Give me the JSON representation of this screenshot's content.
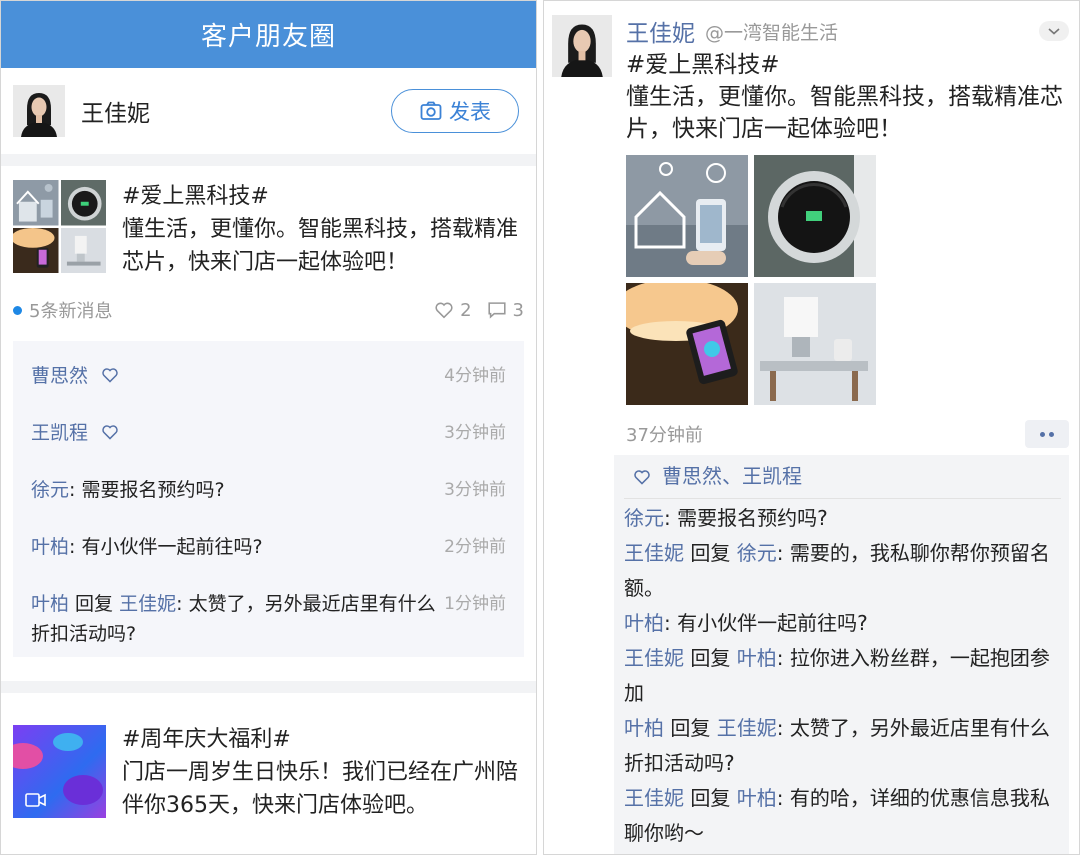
{
  "left": {
    "nav_title": "客户朋友圈",
    "me": {
      "name": "王佳妮",
      "post_button": "发表"
    },
    "post1": {
      "hashtag": "#爱上黑科技#",
      "text": "懂生活，更懂你。智能黑科技，搭载精准芯片，快来门店一起体验吧！",
      "new_messages": "5条新消息",
      "likes": "2",
      "comments": "3",
      "comment_list": [
        {
          "name": "曹思然",
          "text": "",
          "liked": true,
          "time": "4分钟前"
        },
        {
          "name": "王凯程",
          "text": "",
          "liked": true,
          "time": "3分钟前"
        },
        {
          "name": "徐元",
          "text": ": 需要报名预约吗?",
          "liked": false,
          "time": "3分钟前"
        },
        {
          "name": "叶柏",
          "text": ": 有小伙伴一起前往吗?",
          "liked": false,
          "time": "2分钟前"
        },
        {
          "name": "叶柏",
          "reply_word": " 回复 ",
          "reply_to": "王佳妮",
          "text": ": 太赞了，另外最近店里有什么折扣活动吗?",
          "liked": false,
          "time": "1分钟前"
        }
      ]
    },
    "post2": {
      "hashtag": "#周年庆大福利#",
      "text": "门店一周岁生日快乐！我们已经在广州陪伴你365天，快来门店体验吧。"
    }
  },
  "right": {
    "name": "王佳妮",
    "handle": "@一湾智能生活",
    "hashtag": "#爱上黑科技#",
    "text": "懂生活，更懂你。智能黑科技，搭载精准芯片，快来门店一起体验吧！",
    "time": "37分钟前",
    "likes_line": "曹思然、王凯程",
    "comments": [
      {
        "name": "徐元",
        "reply_word": "",
        "reply_to": "",
        "text": ": 需要报名预约吗?"
      },
      {
        "name": "王佳妮",
        "reply_word": " 回复 ",
        "reply_to": "徐元",
        "text": ": 需要的，我私聊你帮你预留名额。"
      },
      {
        "name": "叶柏",
        "reply_word": "",
        "reply_to": "",
        "text": ": 有小伙伴一起前往吗?"
      },
      {
        "name": "王佳妮",
        "reply_word": " 回复 ",
        "reply_to": "叶柏",
        "text": ": 拉你进入粉丝群，一起抱团参加"
      },
      {
        "name": "叶柏",
        "reply_word": " 回复 ",
        "reply_to": "王佳妮",
        "text": ": 太赞了，另外最近店里有什么折扣活动吗?"
      },
      {
        "name": "王佳妮",
        "reply_word": " 回复 ",
        "reply_to": "叶柏",
        "text": ": 有的哈，详细的优惠信息我私聊你哟～"
      }
    ]
  },
  "colors": {
    "nav": "#4a90d9",
    "link": "#5571a7",
    "unread_dot": "#1e88e5"
  }
}
